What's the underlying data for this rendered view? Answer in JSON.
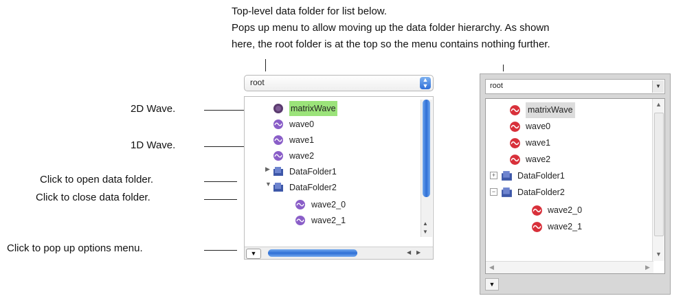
{
  "annotations": {
    "top": [
      "Top-level data folder for list below.",
      "Pops up menu to allow moving up the data folder hierarchy. As shown",
      "here, the root folder is at the top so the menu contains nothing further."
    ],
    "wave2d": "2D Wave.",
    "wave1d": "1D Wave.",
    "open_folder": "Click to open data folder.",
    "close_folder": "Click to close data folder.",
    "options_menu": "Click to pop up options menu."
  },
  "mac_panel": {
    "folder": "root",
    "items": [
      {
        "name": "matrixWave",
        "kind": "2d-wave"
      },
      {
        "name": "wave0",
        "kind": "wave"
      },
      {
        "name": "wave1",
        "kind": "wave"
      },
      {
        "name": "wave2",
        "kind": "wave"
      },
      {
        "name": "DataFolder1",
        "kind": "folder",
        "state": "collapsed"
      },
      {
        "name": "DataFolder2",
        "kind": "folder",
        "state": "expanded"
      },
      {
        "name": "wave2_0",
        "kind": "wave",
        "nested": true
      },
      {
        "name": "wave2_1",
        "kind": "wave",
        "nested": true
      }
    ]
  },
  "win_panel": {
    "folder": "root",
    "items": [
      {
        "name": "matrixWave",
        "kind": "wave"
      },
      {
        "name": "wave0",
        "kind": "wave"
      },
      {
        "name": "wave1",
        "kind": "wave"
      },
      {
        "name": "wave2",
        "kind": "wave"
      },
      {
        "name": "DataFolder1",
        "kind": "folder",
        "state": "collapsed"
      },
      {
        "name": "DataFolder2",
        "kind": "folder",
        "state": "expanded"
      },
      {
        "name": "wave2_0",
        "kind": "wave",
        "nested": true
      },
      {
        "name": "wave2_1",
        "kind": "wave",
        "nested": true
      }
    ]
  },
  "colors": {
    "selection_highlight": "#9be37a",
    "mac_scroll_blue": "#2e6fd6",
    "wave_icon_red": "#d8303a",
    "wave_icon_purple": "#8a5ec8",
    "folder_icon_blue": "#3d57a8"
  },
  "icons": {
    "wave": "wave-icon",
    "matrix": "matrix-wave-icon",
    "folder": "data-folder-icon",
    "disclosure_closed": "triangle-right-icon",
    "disclosure_open": "triangle-down-icon",
    "options": "triangle-down-icon"
  }
}
